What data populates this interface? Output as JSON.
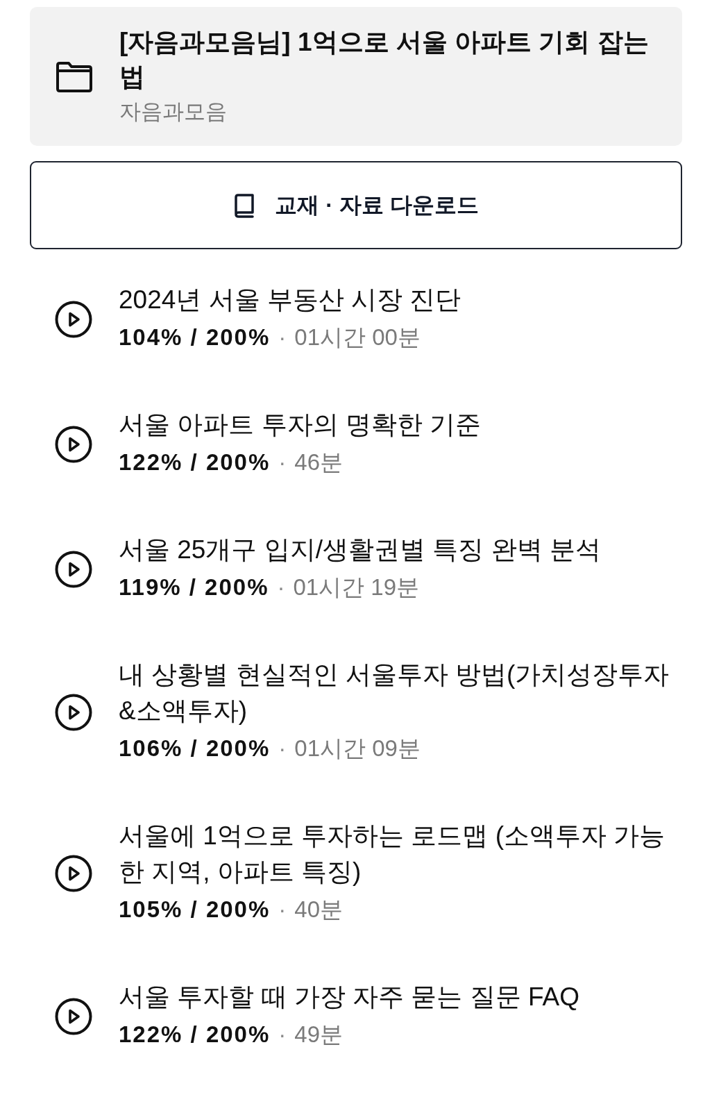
{
  "course": {
    "title": "[자음과모음님] 1억으로 서울 아파트 기회 잡는 법",
    "author": "자음과모음"
  },
  "download_button": {
    "label": "교재 · 자료 다운로드"
  },
  "lessons": [
    {
      "title": "2024년 서울 부동산 시장 진단",
      "progress": "104% / 200%",
      "separator": "·",
      "duration": "01시간 00분"
    },
    {
      "title": "서울 아파트 투자의 명확한 기준",
      "progress": "122% / 200%",
      "separator": "·",
      "duration": "46분"
    },
    {
      "title": "서울 25개구 입지/생활권별 특징 완벽 분석",
      "progress": "119% / 200%",
      "separator": "·",
      "duration": "01시간 19분"
    },
    {
      "title": "내 상황별 현실적인 서울투자 방법(가치성장투자&소액투자)",
      "progress": "106% / 200%",
      "separator": "·",
      "duration": "01시간 09분"
    },
    {
      "title": "서울에 1억으로 투자하는 로드맵 (소액투자 가능한 지역, 아파트 특징)",
      "progress": "105% / 200%",
      "separator": "·",
      "duration": "40분"
    },
    {
      "title": "서울 투자할 때 가장 자주 묻는 질문 FAQ",
      "progress": "122% / 200%",
      "separator": "·",
      "duration": "49분"
    }
  ]
}
